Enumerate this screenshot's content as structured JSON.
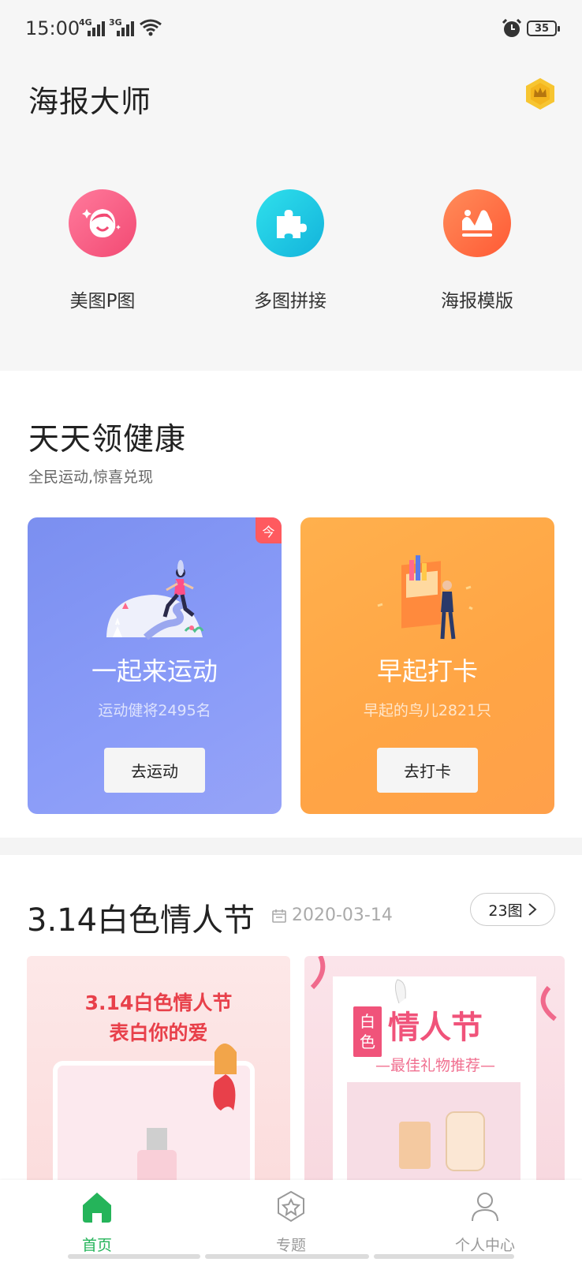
{
  "status_bar": {
    "time": "15:00",
    "net1": "4G",
    "net2": "3G",
    "battery": "35"
  },
  "header": {
    "title": "海报大师",
    "badge_icon": "vip-crown-icon"
  },
  "features": [
    {
      "label": "美图P图",
      "icon": "face-icon",
      "color": "#f5527a"
    },
    {
      "label": "多图拼接",
      "icon": "puzzle-icon",
      "color": "#17c3de"
    },
    {
      "label": "海报模版",
      "icon": "landscape-icon",
      "color": "#ff6a3d"
    }
  ],
  "health": {
    "title": "天天领健康",
    "subtitle": "全民运动,惊喜兑现",
    "cards": [
      {
        "title": "一起来运动",
        "subtitle": "运动健将2495名",
        "button": "去运动",
        "tag": "今"
      },
      {
        "title": "早起打卡",
        "subtitle": "早起的鸟儿2821只",
        "button": "去打卡"
      }
    ]
  },
  "valentine": {
    "title": "3.14白色情人节",
    "date": "2020-03-14",
    "count": "23图",
    "poster1": {
      "line1": "3.14白色情人节",
      "line2": "表白你的爱"
    },
    "poster2": {
      "block_top": "白",
      "block_bottom": "色",
      "big": "情人节",
      "sub": "—最佳礼物推荐—"
    }
  },
  "tab_bar": {
    "tabs": [
      {
        "label": "首页",
        "icon": "home-icon",
        "active": true
      },
      {
        "label": "专题",
        "icon": "star-badge-icon",
        "active": false
      },
      {
        "label": "个人中心",
        "icon": "person-icon",
        "active": false
      }
    ]
  },
  "colors": {
    "accent_green": "#25b45a",
    "sport_card": "#8a9cf8",
    "early_card": "#ffa545",
    "poster_red": "#e8404a"
  }
}
